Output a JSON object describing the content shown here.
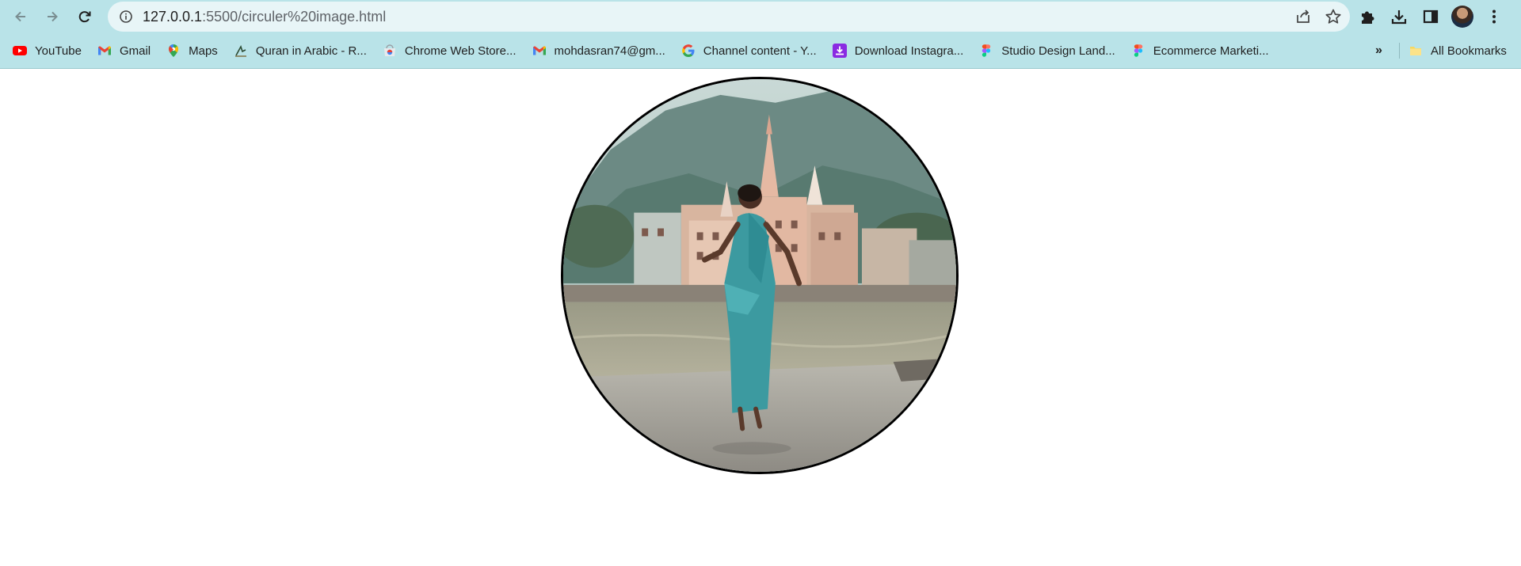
{
  "browser": {
    "url_host": "127.0.0.1",
    "url_path": ":5500/circuler%20image.html",
    "icons": {
      "back": "arrow-left-icon",
      "forward": "arrow-right-icon",
      "reload": "reload-icon",
      "site_info": "info-icon",
      "share": "share-icon",
      "bookmark_star": "star-icon",
      "extensions": "puzzle-icon",
      "downloads": "download-icon",
      "side_panel": "side-panel-icon",
      "profile": "avatar",
      "menu": "kebab-menu-icon"
    }
  },
  "bookmarks": {
    "items": [
      {
        "label": "YouTube",
        "icon": "youtube-icon"
      },
      {
        "label": "Gmail",
        "icon": "gmail-icon"
      },
      {
        "label": "Maps",
        "icon": "maps-icon"
      },
      {
        "label": "Quran in Arabic - R...",
        "icon": "quran-icon"
      },
      {
        "label": "Chrome Web Store...",
        "icon": "chrome-web-store-icon"
      },
      {
        "label": "mohdasran74@gm...",
        "icon": "gmail-icon"
      },
      {
        "label": "Channel content - Y...",
        "icon": "google-icon"
      },
      {
        "label": "Download Instagra...",
        "icon": "download-instagram-icon"
      },
      {
        "label": "Studio Design Land...",
        "icon": "figma-icon"
      },
      {
        "label": "Ecommerce Marketi...",
        "icon": "figma-icon"
      }
    ],
    "overflow": "»",
    "all_bookmarks": "All Bookmarks"
  },
  "colors": {
    "chrome_bg": "#b9e3e8",
    "omnibox_bg": "#e8f5f7",
    "page_bg": "#ffffff",
    "frame_border": "#000000"
  },
  "content": {
    "image": "circular-photo-woman-in-saree-riverside-temple"
  }
}
